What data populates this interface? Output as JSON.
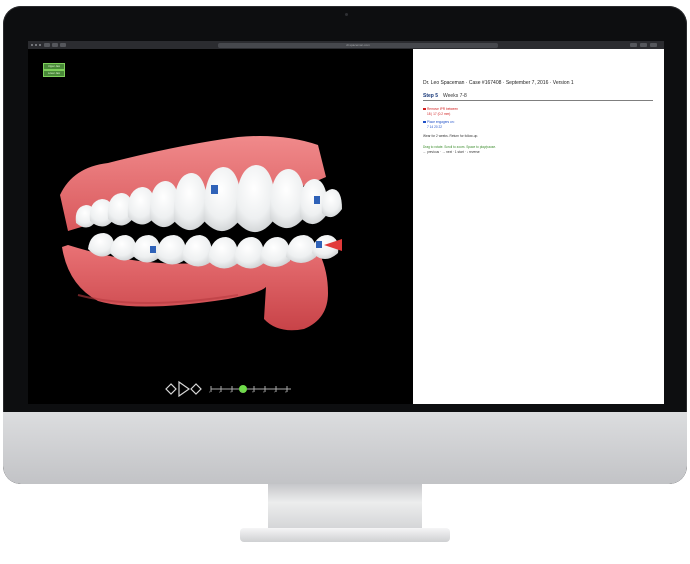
{
  "browser": {
    "url": "dr.spaceman.com"
  },
  "viewer": {
    "buttons": [
      "Upper Jaw",
      "Lower Jaw"
    ],
    "timeline_ticks": [
      "1",
      "2",
      "3",
      "4",
      "5",
      "6",
      "7",
      "8"
    ]
  },
  "panel": {
    "title": "Dr. Leo Spaceman · Case #167408 · September 7, 2016 · Version 1",
    "step_label": "Step 5",
    "weeks_label": "Weeks 7-8",
    "notes": [
      {
        "text": "Remove IPR between",
        "color": "#d12020"
      },
      {
        "text": "18 | 17 (0.2 mm)",
        "color": "#d12020"
      },
      {
        "text": "Place engagers on:",
        "color": "#1f50c8"
      },
      {
        "text": "7  14  20  22",
        "color": "#1f50c8"
      },
      {
        "text": "Wear for 2 weeks. Return for follow-up.",
        "color": "#333333"
      },
      {
        "text": "Drag to rotate. Scroll to zoom. Space to play/pause.",
        "color": "#3b8c2c"
      },
      {
        "text": "← previous · → next · 1 start · ↓ reverse",
        "color": "#333333"
      }
    ]
  },
  "colors": {
    "accent_green": "#4a8a39",
    "gum": "#e06b6d",
    "engager": "#2f62b8",
    "ipr_marker": "#e23a3a"
  }
}
